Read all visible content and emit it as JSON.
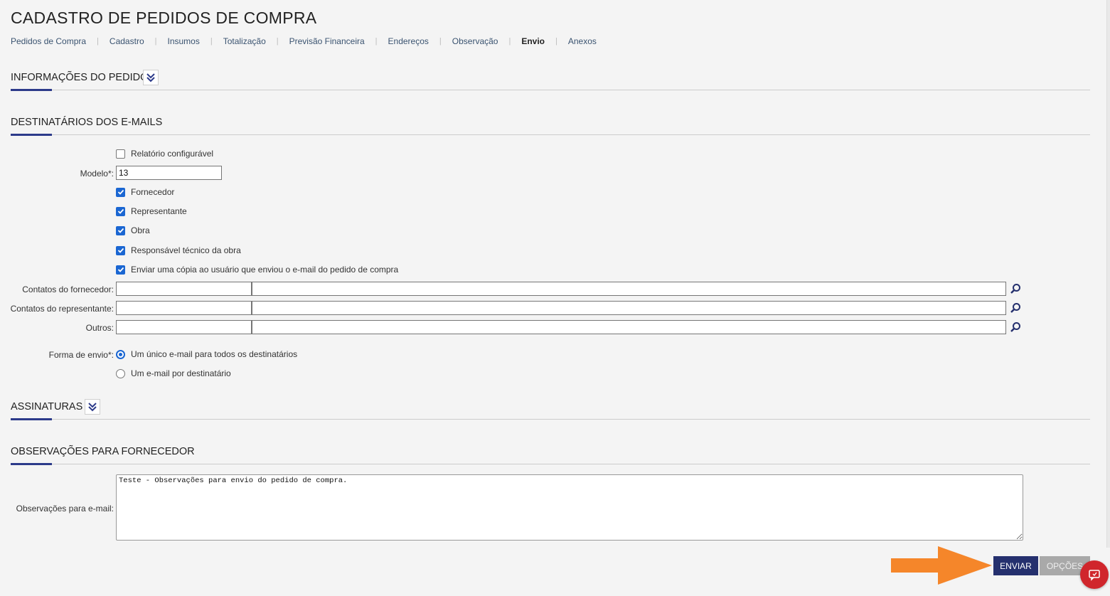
{
  "page": {
    "title": "CADASTRO DE PEDIDOS DE COMPRA"
  },
  "tabs": [
    {
      "label": "Pedidos de Compra"
    },
    {
      "label": "Cadastro"
    },
    {
      "label": "Insumos"
    },
    {
      "label": "Totalização"
    },
    {
      "label": "Previsão Financeira"
    },
    {
      "label": "Endereços"
    },
    {
      "label": "Observação"
    },
    {
      "label": "Envio",
      "active": true
    },
    {
      "label": "Anexos"
    }
  ],
  "sections": {
    "info_pedido": "INFORMAÇÕES DO PEDIDO",
    "destinatarios": "DESTINATÁRIOS DOS E-MAILS",
    "assinaturas": "ASSINATURAS",
    "observacoes": "OBSERVAÇÕES PARA FORNECEDOR"
  },
  "form": {
    "relatorio_configuravel": {
      "label": "Relatório configurável",
      "checked": false
    },
    "modelo": {
      "label": "Modelo*:",
      "value": "13"
    },
    "recipients": [
      {
        "label": "Fornecedor",
        "checked": true
      },
      {
        "label": "Representante",
        "checked": true
      },
      {
        "label": "Obra",
        "checked": true
      },
      {
        "label": "Responsável técnico da obra",
        "checked": true
      },
      {
        "label": "Enviar uma cópia ao usuário que enviou o e-mail do pedido de compra",
        "checked": true
      }
    ],
    "contatos_fornecedor": {
      "label": "Contatos do fornecedor:",
      "value1": "",
      "value2": ""
    },
    "contatos_representante": {
      "label": "Contatos do representante:",
      "value1": "",
      "value2": ""
    },
    "outros": {
      "label": "Outros:",
      "value1": "",
      "value2": ""
    },
    "forma_envio": {
      "label": "Forma de envio*:",
      "options": [
        {
          "label": "Um único e-mail para todos os destinatários",
          "selected": true
        },
        {
          "label": "Um e-mail por destinatário",
          "selected": false
        }
      ]
    },
    "observacoes_email": {
      "label": "Observações para e-mail:",
      "value": "Teste - Observações para envio do pedido de compra."
    }
  },
  "actions": {
    "enviar": "ENVIAR",
    "opcoes": "OPÇÕES"
  },
  "colors": {
    "accent": "#25306e",
    "checkbox": "#1a66d2",
    "arrow": "#f5862a",
    "chat": "#d0262c"
  },
  "icons": {
    "collapse": "double-chevron-down-icon",
    "search": "magnifier-icon",
    "chat": "chat-icon"
  }
}
